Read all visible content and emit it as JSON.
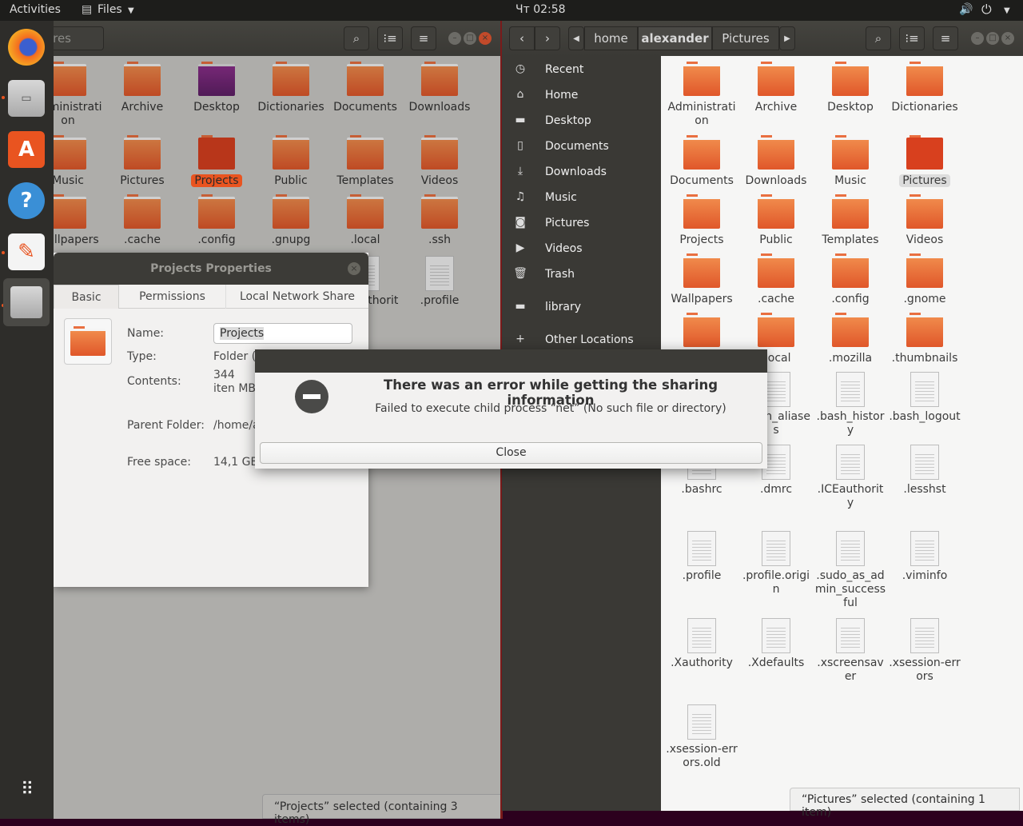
{
  "topbar": {
    "activities": "Activities",
    "app_menu": "Files",
    "clock": "Чт 02:58"
  },
  "dock": {
    "apps": [
      "firefox-icon",
      "files-icon",
      "software-center-icon",
      "help-icon",
      "text-editor-icon",
      "files-icon"
    ],
    "show_apps": "apps-grid-icon"
  },
  "left_window": {
    "path_partial": "Pictures",
    "items": [
      [
        "Administration",
        "folder"
      ],
      [
        "Archive",
        "folder"
      ],
      [
        "Desktop",
        "desktop"
      ],
      [
        "Dictionaries",
        "folder"
      ],
      [
        "Documents",
        "folder"
      ],
      [
        "Downloads",
        "folder"
      ],
      [
        "Music",
        "folder"
      ],
      [
        "Pictures",
        "folder"
      ],
      [
        "Projects",
        "folder-selected"
      ],
      [
        "Public",
        "folder"
      ],
      [
        "Templates",
        "folder"
      ],
      [
        "Videos",
        "folder"
      ],
      [
        "Wallpapers",
        "folder"
      ],
      [
        ".cache",
        "folder"
      ],
      [
        ".config",
        "folder"
      ],
      [
        ".gnupg",
        "folder"
      ],
      [
        ".local",
        "folder"
      ],
      [
        ".ssh",
        "folder"
      ],
      [
        "",
        "file"
      ],
      [
        "",
        "file"
      ],
      [
        "",
        "file"
      ],
      [
        "",
        "file"
      ],
      [
        ".ICEauthority",
        "file"
      ],
      [
        ".profile",
        "file"
      ]
    ],
    "status": "“Projects” selected  (containing 3 items)"
  },
  "right_window": {
    "breadcrumb": [
      "home",
      "alexander",
      "Pictures"
    ],
    "sidebar": [
      [
        "Recent",
        "◷"
      ],
      [
        "Home",
        "⌂"
      ],
      [
        "Desktop",
        "▬"
      ],
      [
        "Documents",
        "▯"
      ],
      [
        "Downloads",
        "⤓"
      ],
      [
        "Music",
        "♫"
      ],
      [
        "Pictures",
        "◙"
      ],
      [
        "Videos",
        "▶"
      ],
      [
        "Trash",
        "🗑"
      ],
      [
        "library",
        "▬"
      ],
      [
        "Other Locations",
        "+"
      ]
    ],
    "items": [
      [
        "Administration",
        "folder"
      ],
      [
        "Archive",
        "folder"
      ],
      [
        "Desktop",
        "folder"
      ],
      [
        "Dictionaries",
        "folder"
      ],
      [
        "Documents",
        "folder"
      ],
      [
        "Downloads",
        "folder"
      ],
      [
        "Music",
        "folder"
      ],
      [
        "Pictures",
        "folder-selected"
      ],
      [
        "Projects",
        "folder"
      ],
      [
        "Public",
        "folder"
      ],
      [
        "Templates",
        "folder"
      ],
      [
        "Videos",
        "folder"
      ],
      [
        "Wallpapers",
        "folder"
      ],
      [
        ".cache",
        "folder"
      ],
      [
        ".config",
        "folder"
      ],
      [
        ".gnome",
        "folder"
      ],
      [
        "",
        "folder"
      ],
      [
        ".local",
        "folder"
      ],
      [
        ".mozilla",
        "folder"
      ],
      [
        ".thumbnails",
        "folder"
      ],
      [
        "",
        "file"
      ],
      [
        ".bash_aliases",
        "file"
      ],
      [
        ".bash_history",
        "file"
      ],
      [
        ".bash_logout",
        "file"
      ],
      [
        ".bashrc",
        "file"
      ],
      [
        ".dmrc",
        "file"
      ],
      [
        ".ICEauthority",
        "file"
      ],
      [
        ".lesshst",
        "file"
      ],
      [
        ".profile",
        "file"
      ],
      [
        ".profile.origin",
        "file"
      ],
      [
        ".sudo_as_admin_successful",
        "file"
      ],
      [
        ".viminfo",
        "file"
      ],
      [
        ".Xauthority",
        "file"
      ],
      [
        ".Xdefaults",
        "file"
      ],
      [
        ".xscreensaver",
        "file"
      ],
      [
        ".xsession-errors",
        "file"
      ],
      [
        ".xsession-errors.old",
        "file"
      ]
    ],
    "status": "“Pictures” selected  (containing 1 item)"
  },
  "properties": {
    "title": "Projects Properties",
    "tabs": [
      "Basic",
      "Permissions",
      "Local Network Share"
    ],
    "name_label": "Name:",
    "name_value": "Projects",
    "type_label": "Type:",
    "type_value": "Folder (",
    "contents_label": "Contents:",
    "contents_value": "344 iten MB",
    "parent_label": "Parent Folder:",
    "parent_value": "/home/a",
    "free_label": "Free space:",
    "free_value": "14,1 GB"
  },
  "error": {
    "title": "There was an error while getting the sharing information",
    "message": "Failed to execute child process “net” (No such file or directory)",
    "close": "Close"
  }
}
